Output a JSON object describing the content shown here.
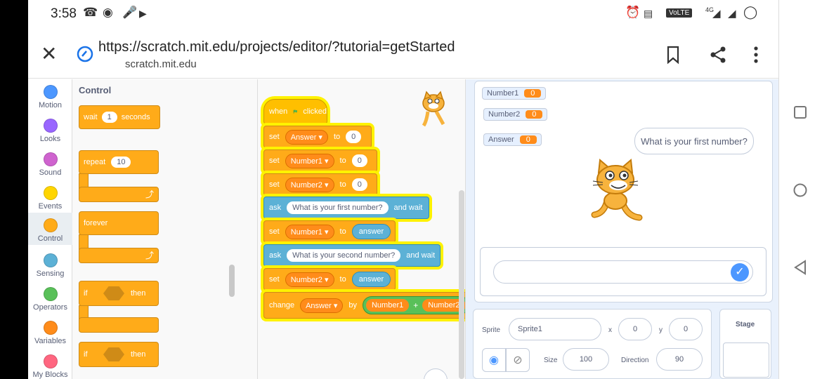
{
  "status_bar": {
    "time": "3:58",
    "network": "VoLTE",
    "net_type": "4G"
  },
  "browser": {
    "url": "https://scratch.mit.edu/projects/editor/?tutorial=getStarted",
    "host": "scratch.mit.edu",
    "close_icon": "close-icon",
    "secure_icon": "secure-icon",
    "bookmark_icon": "bookmark-icon",
    "share_icon": "share-icon",
    "menu_icon": "more-vert-icon"
  },
  "categories": [
    {
      "label": "Motion",
      "color": "#4c97ff"
    },
    {
      "label": "Looks",
      "color": "#9966ff"
    },
    {
      "label": "Sound",
      "color": "#cf63cf"
    },
    {
      "label": "Events",
      "color": "#ffd500"
    },
    {
      "label": "Control",
      "color": "#ffab19",
      "active": true
    },
    {
      "label": "Sensing",
      "color": "#5cb1d6"
    },
    {
      "label": "Operators",
      "color": "#59c059"
    },
    {
      "label": "Variables",
      "color": "#ff8c1a"
    },
    {
      "label": "My Blocks",
      "color": "#ff6680"
    }
  ],
  "palette": {
    "title": "Control",
    "wait": {
      "label": "wait",
      "value": "1",
      "suffix": "seconds"
    },
    "repeat": {
      "label": "repeat",
      "value": "10"
    },
    "forever": {
      "label": "forever"
    },
    "if1": {
      "label": "if",
      "then": "then"
    },
    "if2": {
      "label": "if",
      "then": "then"
    }
  },
  "script": {
    "hat": {
      "when": "when",
      "clicked": "clicked"
    },
    "set1": {
      "op": "set",
      "var": "Answer",
      "to": "to",
      "value": "0"
    },
    "set2": {
      "op": "set",
      "var": "Number1",
      "to": "to",
      "value": "0"
    },
    "set3": {
      "op": "set",
      "var": "Number2",
      "to": "to",
      "value": "0"
    },
    "ask1": {
      "op": "ask",
      "text": "What is your first number?",
      "suffix": "and wait"
    },
    "set4": {
      "op": "set",
      "var": "Number1",
      "to": "to",
      "value": "answer"
    },
    "ask2": {
      "op": "ask",
      "text": "What is your second number?",
      "suffix": "and wait"
    },
    "set5": {
      "op": "set",
      "var": "Number2",
      "to": "to",
      "value": "answer"
    },
    "change": {
      "op": "change",
      "var": "Answer",
      "by": "by",
      "left": "Number1",
      "plus": "+",
      "right": "Number2"
    }
  },
  "stage": {
    "monitors": [
      {
        "name": "Number1",
        "value": "0"
      },
      {
        "name": "Number2",
        "value": "0"
      },
      {
        "name": "Answer",
        "value": "0"
      }
    ],
    "bubble": "What is your first number?"
  },
  "sprite_info": {
    "sprite_label": "Sprite",
    "sprite_name": "Sprite1",
    "x_label": "x",
    "x": "0",
    "y_label": "y",
    "y": "0",
    "size_label": "Size",
    "size": "100",
    "direction_label": "Direction",
    "direction": "90",
    "stage_label": "Stage"
  }
}
